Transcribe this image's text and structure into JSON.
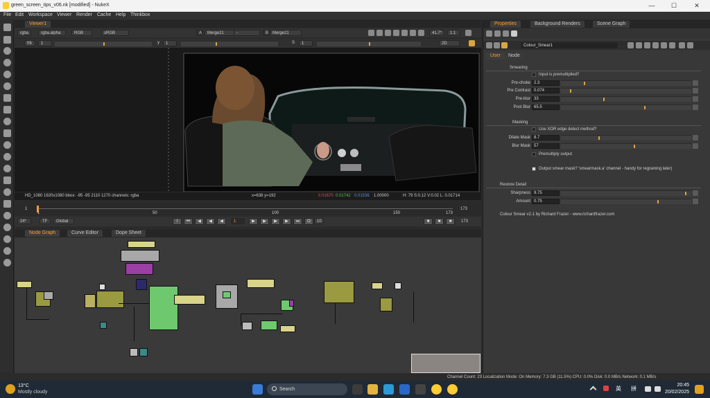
{
  "window": {
    "title": "green_screen_tips_v06.nk [modified] - NukeX",
    "minimize": "—",
    "maximize": "☐",
    "close": "✕"
  },
  "menu": [
    "File",
    "Edit",
    "Workspace",
    "Viewer",
    "Render",
    "Cache",
    "Help",
    "Thinkbox"
  ],
  "viewer": {
    "tab": "Viewer1",
    "channels": "rgba",
    "layer": "rgba.alpha",
    "colorspace_mode": "RGB",
    "display": "sRGB",
    "a_input": "Merge21",
    "op": "-",
    "b_input": "Merge21",
    "zoom": "41.7*",
    "ratio": "1:1",
    "fstop": "f/8",
    "frame_field": "1",
    "y_label": "y",
    "y_val": "1",
    "s_label": "S",
    "s_val": "1",
    "mode": "2D"
  },
  "info": {
    "format": "HD_1080 1920x1080  bbox: -95 -95 2110 1270 channels: rgba",
    "coords": "x=638 y=192",
    "r": "0.01670",
    "g": "0.01742",
    "b": "0.01536",
    "a": "1.00000",
    "hsv": "H: 79 S:0.12 V:0.02  L: 0.01714"
  },
  "timeline": {
    "start": "1",
    "end": "173",
    "ticks": [
      "1",
      "50",
      "100",
      "150",
      "173"
    ],
    "current": "1",
    "end_field": "173"
  },
  "playback": {
    "fps": "24*",
    "tf": "TF",
    "scope": "Global",
    "frame": "1",
    "inc": "10"
  },
  "nodegraph": {
    "tabs": [
      "Node Graph",
      "Curve Editor",
      "Dope Sheet"
    ]
  },
  "properties": {
    "tabs": [
      "Properties",
      "Background Renders",
      "Scene Graph"
    ],
    "node_name": "Colour_Smear1",
    "subtabs": [
      "User",
      "Node"
    ],
    "smearing": {
      "header": "Smearing",
      "premult_label": "Input is premultiplied?",
      "fields": [
        {
          "label": "Pre-choke",
          "value": "2.3",
          "pos": 0.18
        },
        {
          "label": "Pre Contrast",
          "value": "0.074",
          "pos": 0.07
        },
        {
          "label": "Pre-blur",
          "value": "33",
          "pos": 0.33
        },
        {
          "label": "Post Blur",
          "value": "65.5",
          "pos": 0.65
        }
      ]
    },
    "masking": {
      "header": "Masking",
      "xor_label": "Use XOR edge detect method?",
      "fields": [
        {
          "label": "Dilate Mask",
          "value": "8.7",
          "pos": 0.29
        },
        {
          "label": "Blur Mask",
          "value": "57",
          "pos": 0.57
        }
      ],
      "premult_output": "Premultiply output",
      "output_mask": "Output smear mask? 'smearmask.a' channel - handy for regraining later)"
    },
    "restore": {
      "header": "Restore Detail",
      "fields": [
        {
          "label": "Sharpness",
          "value": "9.75",
          "pos": 0.97
        },
        {
          "label": "Amount",
          "value": "0.75",
          "pos": 0.75
        }
      ]
    },
    "credit": "Colour Smear v2.1 by Richard Frazer - www.richardfrazer.com"
  },
  "status": "Channel Count: 23  Localization Mode: On  Memory: 7.3 GB (11.5%)  CPU: 0.0%  Disk: 0.0 MB/s  Network: 0.1 MB/s",
  "taskbar": {
    "weather_temp": "13°C",
    "weather_desc": "Mostly cloudy",
    "search": "Search",
    "ime1": "英",
    "ime2": "拼",
    "time": "20:45",
    "date": "20/02/2025"
  },
  "colors": {
    "accent": "#ff9d2e",
    "knob": "#d9a441",
    "taskbar": "#1f2a36"
  }
}
